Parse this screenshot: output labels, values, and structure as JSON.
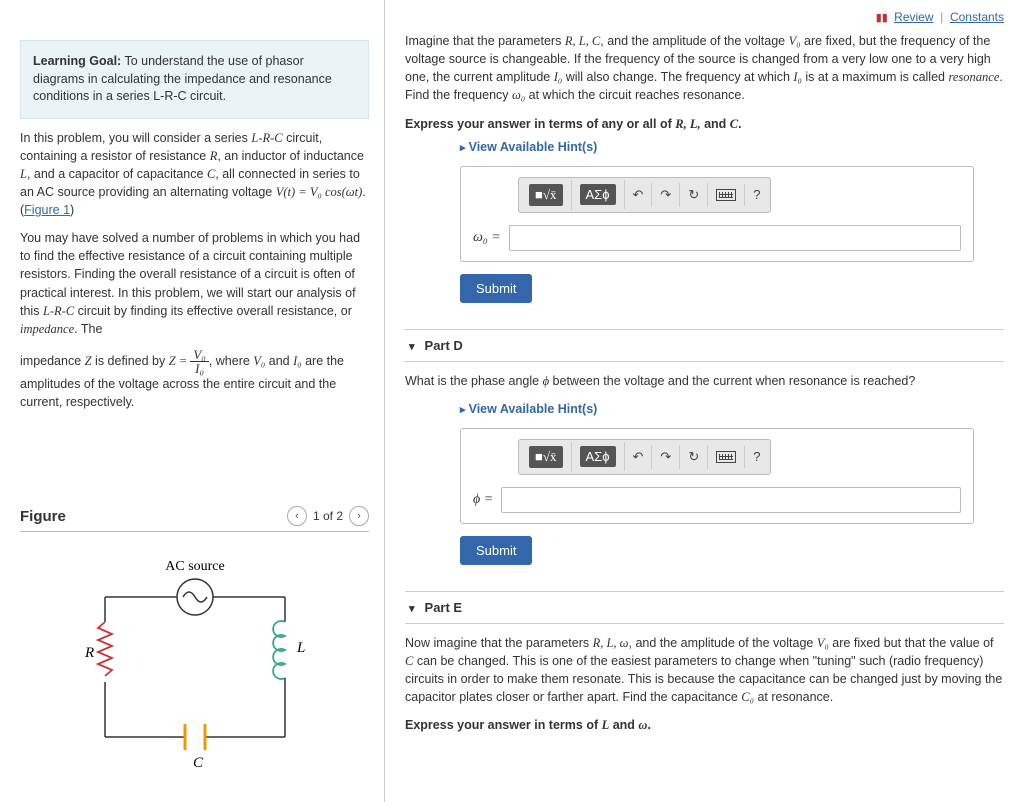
{
  "top": {
    "review": "Review",
    "constants": "Constants"
  },
  "learning_goal": {
    "title": "Learning Goal:",
    "text": "To understand the use of phasor diagrams in calculating the impedance and resonance conditions in a series L-R-C circuit."
  },
  "intro": {
    "p1a": "In this problem, you will consider a series ",
    "p1b": " circuit, containing a resistor of resistance ",
    "p1c": ", an inductor of inductance ",
    "p1d": ", and a capacitor of capacitance ",
    "p1e": ", all connected in series to an AC source providing an alternating voltage ",
    "lrc": "L-R-C",
    "voltage_eq": "V(t) = V₀ cos(ωt)",
    "fig1link": "Figure 1",
    "p2": "You may have solved a number of problems in which you had to find the effective resistance of a circuit containing multiple resistors. Finding the overall resistance of a circuit is often of practical interest. In this problem, we will start our analysis of this ",
    "p2b": " circuit by finding its effective overall resistance, or ",
    "impedance_word": "impedance",
    "p2c": ". The",
    "p3a": "impedance ",
    "p3b": " is defined by ",
    "p3c": ", where ",
    "p3d": " and ",
    "p3e": " are the amplitudes of the voltage across the entire circuit and the current, respectively."
  },
  "figure": {
    "title": "Figure",
    "counter": "1 of 2",
    "labels": {
      "source": "AC source",
      "R": "R",
      "L": "L",
      "C": "C"
    }
  },
  "partC": {
    "prompt_a": "Imagine that the parameters ",
    "prompt_b": ", and the amplitude of the voltage ",
    "prompt_c": " are fixed, but the frequency of the voltage source is changeable. If the frequency of the source is changed from a very low one to a very high one, the current amplitude ",
    "prompt_d": " will also change. The frequency at which ",
    "prompt_e": " is at a maximum is called ",
    "resonance": "resonance",
    "prompt_f": ". Find the frequency ",
    "prompt_g": " at which the circuit reaches resonance.",
    "express": "Express your answer in terms of any or all of ",
    "express_end": ".",
    "hints": "View Available Hint(s)",
    "var_label": "ω₀ =",
    "submit": "Submit"
  },
  "partD": {
    "title": "Part D",
    "prompt": "What is the phase angle ",
    "prompt2": " between the voltage and the current when resonance is reached?",
    "hints": "View Available Hint(s)",
    "var_label": "ϕ =",
    "submit": "Submit"
  },
  "partE": {
    "title": "Part E",
    "prompt_a": "Now imagine that the parameters ",
    "prompt_b": ", and the amplitude of the voltage ",
    "prompt_c": " are fixed but that the value of ",
    "prompt_d": " can be changed. This is one of the easiest parameters to change when \"tuning\" such (radio frequency) circuits in order to make them resonate. This is because the capacitance can be changed just by moving the capacitor plates closer or farther apart. Find the capacitance ",
    "prompt_e": " at resonance.",
    "express": "Express your answer in terms of ",
    "express_end": "."
  },
  "toolbar": {
    "templates": "■√x̄",
    "greek": "ΑΣϕ",
    "undo": "↶",
    "redo": "↷",
    "reset": "↻",
    "help": "?"
  }
}
